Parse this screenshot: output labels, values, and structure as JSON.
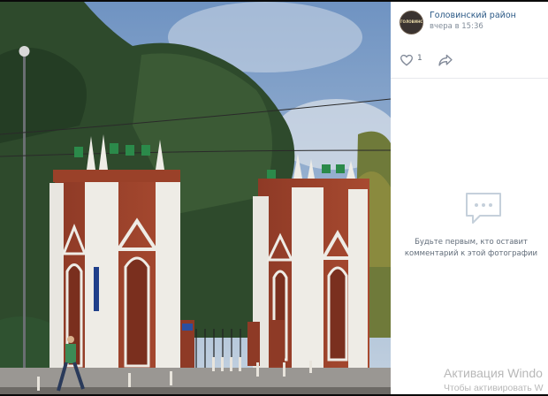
{
  "post": {
    "group_name": "Головинский район",
    "time": "вчера в 15:36",
    "likes": "1"
  },
  "comments": {
    "empty_text": "Будьте первым, кто оставит комментарий к этой фотографии"
  },
  "icons": {
    "like": "heart-icon",
    "share": "share-arrow-icon",
    "empty_comments": "comment-bubble-icon"
  },
  "watermark": {
    "title": "Активация Windo",
    "subtitle": "Чтобы активировать W"
  },
  "colors": {
    "link": "#2a5885",
    "secondary_text": "#818c99",
    "sidebar_bg": "#ffffff",
    "page_bg": "#0a0a0a"
  }
}
